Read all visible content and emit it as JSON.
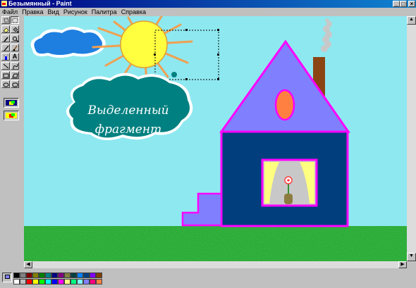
{
  "window": {
    "title": "Безымянный - Paint",
    "minimize_glyph": "_",
    "maximize_glyph": "□",
    "close_glyph": "×"
  },
  "menu": [
    "Файл",
    "Правка",
    "Вид",
    "Рисунок",
    "Палитра",
    "Справка"
  ],
  "tools": [
    {
      "name": "free-select-icon"
    },
    {
      "name": "rect-select-icon"
    },
    {
      "name": "eraser-icon"
    },
    {
      "name": "fill-icon"
    },
    {
      "name": "color-picker-icon"
    },
    {
      "name": "magnifier-icon"
    },
    {
      "name": "pencil-icon"
    },
    {
      "name": "brush-icon"
    },
    {
      "name": "airbrush-icon"
    },
    {
      "name": "text-tool-icon",
      "glyph": "A"
    },
    {
      "name": "line-icon"
    },
    {
      "name": "curve-icon"
    },
    {
      "name": "rectangle-icon"
    },
    {
      "name": "polygon-icon"
    },
    {
      "name": "ellipse-icon"
    },
    {
      "name": "rounded-rect-icon"
    }
  ],
  "canvas": {
    "callout_line1": "Выделенный",
    "callout_line2": "фрагмент",
    "sky_color": "#8ee8f0",
    "grass_color": "#2aa830",
    "house_wall_color": "#003e7e",
    "roof_color": "#8080ff",
    "outline_color": "#ff00ff",
    "sun_color": "#ffff40",
    "cloud_color": "#1f7fe0",
    "callout_color": "#008080",
    "chimney_color": "#8b4513",
    "roof_window_color": "#ff8040"
  },
  "palette": {
    "top_row": [
      "#000000",
      "#808080",
      "#800000",
      "#808000",
      "#008000",
      "#008080",
      "#000080",
      "#800080",
      "#808040",
      "#004040",
      "#0080ff",
      "#004080",
      "#8000ff",
      "#804000"
    ],
    "bottom_row": [
      "#ffffff",
      "#c0c0c0",
      "#ff0000",
      "#ffff00",
      "#00ff00",
      "#00ffff",
      "#0000ff",
      "#ff00ff",
      "#ffff80",
      "#00ff80",
      "#80ffff",
      "#8080ff",
      "#ff0080",
      "#ff8040"
    ]
  }
}
